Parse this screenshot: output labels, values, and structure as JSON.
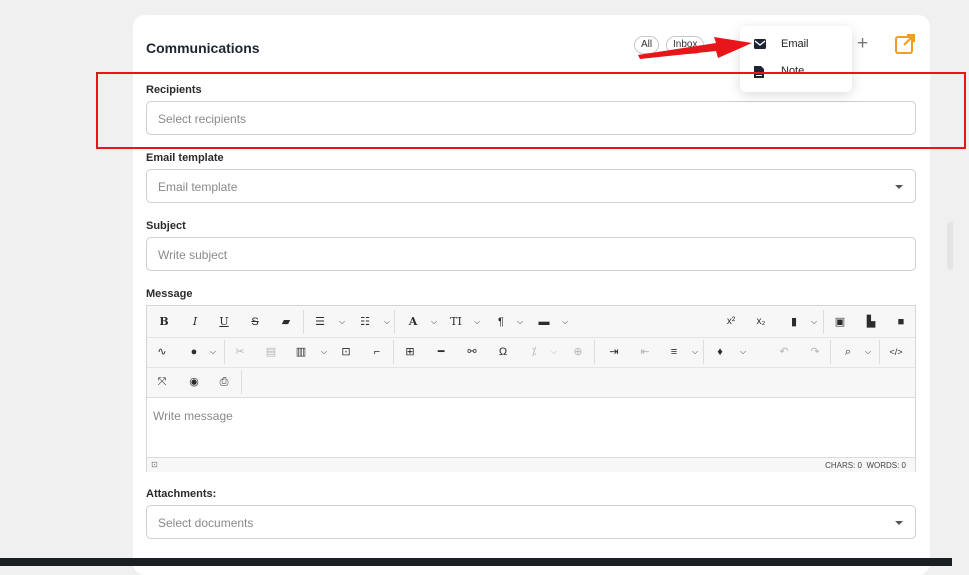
{
  "card": {
    "title": "Communications",
    "filters": [
      "All",
      "Inbox"
    ]
  },
  "add_menu": {
    "items": [
      {
        "label": "Email",
        "icon": "envelope-icon"
      },
      {
        "label": "Note",
        "icon": "note-icon"
      }
    ]
  },
  "form": {
    "recipients": {
      "label": "Recipients",
      "placeholder": "Select recipients"
    },
    "template": {
      "label": "Email template",
      "placeholder": "Email template"
    },
    "subject": {
      "label": "Subject",
      "placeholder": "Write subject"
    },
    "message": {
      "label": "Message",
      "placeholder": "Write message",
      "chars": "CHARS: 0",
      "words": "WORDS: 0"
    },
    "attachments": {
      "label": "Attachments:",
      "placeholder": "Select documents"
    }
  },
  "toolbar": {
    "bold": "B",
    "italic": "I",
    "underline": "U",
    "strike": "S",
    "font": "A",
    "size": "TI",
    "paragraph": "¶",
    "superscript": "x²",
    "subscript": "x₂",
    "omega": "Ω",
    "code": "</>"
  },
  "colors": {
    "accent": "#f59a23",
    "annotation": "#e8161a",
    "icon_dark": "#1f2433"
  }
}
